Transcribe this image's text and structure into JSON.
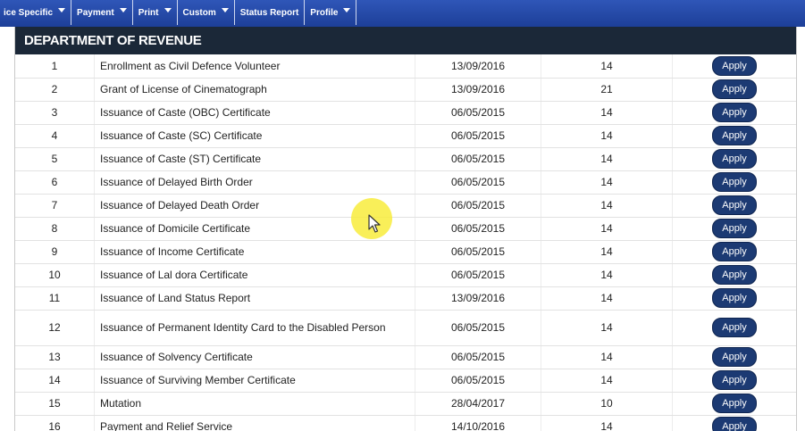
{
  "menu": [
    {
      "label": "ice Specific",
      "has_dropdown": true
    },
    {
      "label": "Payment",
      "has_dropdown": true
    },
    {
      "label": "Print",
      "has_dropdown": true
    },
    {
      "label": "Custom",
      "has_dropdown": true
    },
    {
      "label": "Status Report",
      "has_dropdown": false
    },
    {
      "label": "Profile",
      "has_dropdown": true
    }
  ],
  "panel": {
    "title": "DEPARTMENT OF REVENUE"
  },
  "apply_label": "Apply",
  "rows": [
    {
      "sno": "1",
      "name": "Enrollment as Civil Defence Volunteer",
      "date": "13/09/2016",
      "days": "14"
    },
    {
      "sno": "2",
      "name": "Grant of License of Cinematograph",
      "date": "13/09/2016",
      "days": "21"
    },
    {
      "sno": "3",
      "name": "Issuance of Caste (OBC) Certificate",
      "date": "06/05/2015",
      "days": "14"
    },
    {
      "sno": "4",
      "name": "Issuance of Caste (SC) Certificate",
      "date": "06/05/2015",
      "days": "14"
    },
    {
      "sno": "5",
      "name": "Issuance of Caste (ST) Certificate",
      "date": "06/05/2015",
      "days": "14"
    },
    {
      "sno": "6",
      "name": "Issuance of Delayed Birth Order",
      "date": "06/05/2015",
      "days": "14"
    },
    {
      "sno": "7",
      "name": "Issuance of Delayed Death Order",
      "date": "06/05/2015",
      "days": "14"
    },
    {
      "sno": "8",
      "name": "Issuance of Domicile Certificate",
      "date": "06/05/2015",
      "days": "14"
    },
    {
      "sno": "9",
      "name": "Issuance of Income Certificate",
      "date": "06/05/2015",
      "days": "14"
    },
    {
      "sno": "10",
      "name": "Issuance of Lal dora Certificate",
      "date": "06/05/2015",
      "days": "14"
    },
    {
      "sno": "11",
      "name": "Issuance of Land Status Report",
      "date": "13/09/2016",
      "days": "14"
    },
    {
      "sno": "12",
      "name": "Issuance of Permanent Identity Card to the Disabled Person",
      "date": "06/05/2015",
      "days": "14"
    },
    {
      "sno": "13",
      "name": "Issuance of Solvency Certificate",
      "date": "06/05/2015",
      "days": "14"
    },
    {
      "sno": "14",
      "name": "Issuance of Surviving Member Certificate",
      "date": "06/05/2015",
      "days": "14"
    },
    {
      "sno": "15",
      "name": "Mutation",
      "date": "28/04/2017",
      "days": "10"
    },
    {
      "sno": "16",
      "name": "Payment and Relief Service",
      "date": "14/10/2016",
      "days": "14"
    }
  ],
  "colors": {
    "menubar": "#1d3f98",
    "header": "#1b2838",
    "apply_button": "#1c3a73",
    "highlight": "#f8ec3c"
  }
}
